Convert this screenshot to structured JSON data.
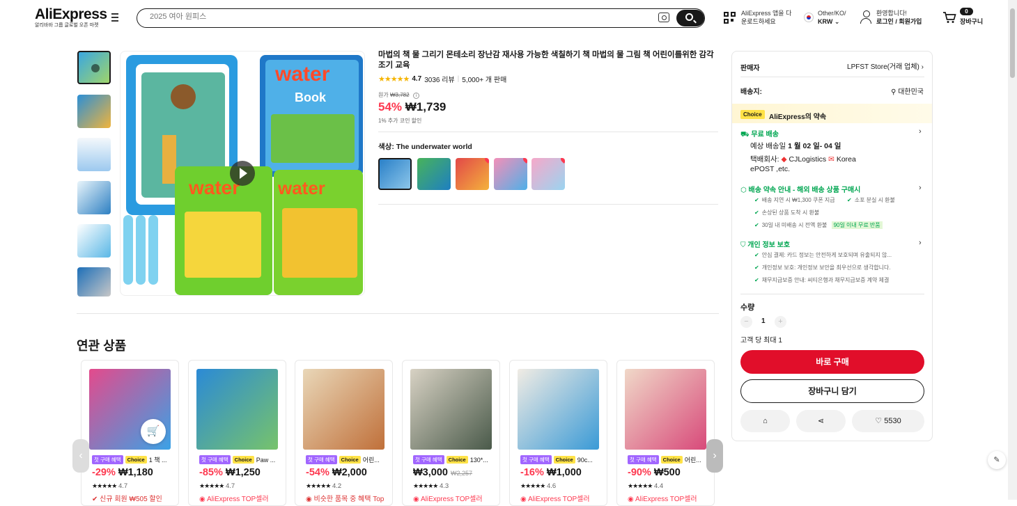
{
  "header": {
    "logo": "AliExpress",
    "logo_sub": "알리바바 그룹 글로벌 오픈 마켓",
    "search_placeholder": "2025 여아 원피스",
    "app_line1": "AliExpress 앱을 다",
    "app_line2": "운로드하세요",
    "locale_line1": "Other/KO/",
    "locale_line2": "KRW",
    "welcome": "환영합니다!",
    "login": "로그인 / 회원가입",
    "cart_count": "0",
    "cart_label": "장바구니"
  },
  "product": {
    "title": "마법의 책 물 그리기 몬테소리 장난감 재사용 가능한 색칠하기 책 마법의 물 그림 책 어린이를위한 감각 조기 교육",
    "rating": "4.7",
    "reviews": "3036 리뷰",
    "sold": "5,000+ 개 판매",
    "orig_label": "원가",
    "orig_price": "₩3,782",
    "discount": "54%",
    "price": "₩1,739",
    "coin_note": "1% 추가 코인 할인",
    "color_label": "색상: The underwater world"
  },
  "related": {
    "title": "연관 상품",
    "first_tag": "첫 구매 혜택",
    "choice_tag": "Choice",
    "cards": [
      {
        "name": "1 책 ...",
        "pct": "-29%",
        "price": "₩1,180",
        "orig": "",
        "rating": "4.7",
        "promo": "신규 회원 ₩505 할인"
      },
      {
        "name": "Paw ...",
        "pct": "-85%",
        "price": "₩1,250",
        "orig": "",
        "rating": "4.7",
        "promo": "AliExpress TOP셀러"
      },
      {
        "name": "어린...",
        "pct": "-54%",
        "price": "₩2,000",
        "orig": "",
        "rating": "4.2",
        "promo": "비슷한 품목 중 혜택 Top"
      },
      {
        "name": "130*...",
        "pct": "",
        "price": "₩3,000",
        "orig": "₩2,257",
        "rating": "4.3",
        "promo": "AliExpress TOP셀러"
      },
      {
        "name": "90c...",
        "pct": "-16%",
        "price": "₩1,000",
        "orig": "",
        "rating": "4.6",
        "promo": "AliExpress TOP셀러"
      },
      {
        "name": "어린...",
        "pct": "-90%",
        "price": "₩500",
        "orig": "",
        "rating": "4.4",
        "promo": "AliExpress TOP셀러"
      }
    ]
  },
  "panel": {
    "seller_label": "판매자",
    "seller_name": "LPFST Store(거래 업체)",
    "ship_to_label": "배송지:",
    "ship_to": "대한민국",
    "choice_logo": "Choice",
    "promise": "AliExpress의 약속",
    "free_shipping": "무료 배송",
    "eta_prefix": "예상 배송일",
    "eta": "1 월 02 일- 04 일",
    "carrier_prefix": "택배회사:",
    "carrier_1": "CJLogistics",
    "carrier_2": "Korea",
    "carrier_3": "ePOST ,etc.",
    "delivery_promise": "배송 약속 안내 - 해외 배송 상품 구매시",
    "d1": "배송 지연 시 ₩1,300 쿠폰 지급",
    "d2": "소포 분실 시 환불",
    "d3": "손상된 상품 도착 시 환불",
    "d4": "30일 내 미배송 시 전액 환불",
    "d4_badge": "90일 이내 무료 반품",
    "privacy": "개인 정보 보호",
    "p1": "안심 결제: 카드 정보는 안전하게 보호되며 유출되지 않...",
    "p2": "개인정보 보호: 개인정보 보안을 최우선으로 생각합니다.",
    "p3": "채무지급보증 안내: 씨티은행과 채무지급보증 계약 체결",
    "qty_label": "수량",
    "qty": "1",
    "qty_limit": "고객 당 최대 1",
    "buy_now": "바로 구매",
    "add_cart": "장바구니 담기",
    "wish_count": "5530"
  }
}
